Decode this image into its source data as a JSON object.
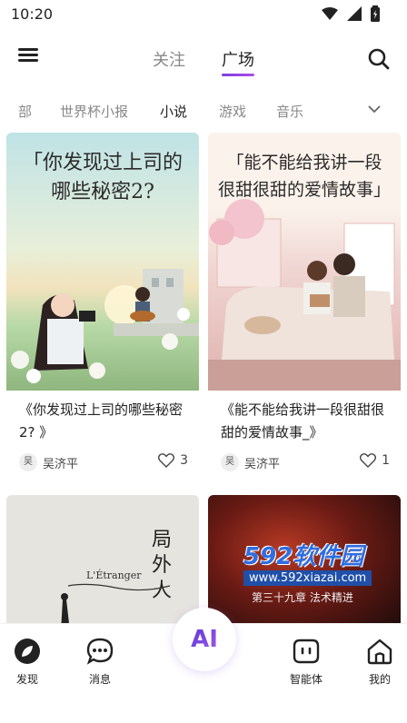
{
  "statusbar": {
    "time": "10:20"
  },
  "topnav": {
    "tabs": [
      {
        "label": "关注",
        "active": false
      },
      {
        "label": "广场",
        "active": true
      }
    ]
  },
  "categories": {
    "items": [
      "部",
      "世界杯小报",
      "小说",
      "游戏",
      "音乐"
    ],
    "active": "小说"
  },
  "cards": [
    {
      "cover_title": "「你发现过上司的哪些秘密2?",
      "cover_title_line1": "「你发现过上司的",
      "cover_title_line2": "哪些秘密2?",
      "title": "《你发现过上司的哪些秘密2? 》",
      "author": "吴济平",
      "avatar_text": "吴",
      "likes": "3"
    },
    {
      "cover_title_line1": "「能不能给我讲一段",
      "cover_title_line2": "很甜很甜的爱情故事」",
      "title": "《能不能给我讲一段很甜很甜的爱情故事_》",
      "author": "吴济平",
      "avatar_text": "吴",
      "likes": "1"
    },
    {
      "cover_text_vertical": "局外人",
      "cover_text_script": "L'Étranger"
    },
    {
      "cover_text_chapter": "第三十九章 法术精进"
    }
  ],
  "bottomnav": {
    "items": [
      {
        "label": "发现",
        "icon": "compass-icon"
      },
      {
        "label": "消息",
        "icon": "chat-icon"
      },
      {
        "label": "智能体",
        "icon": "robot-icon"
      },
      {
        "label": "我的",
        "icon": "home-icon"
      }
    ],
    "ai_label": "AI"
  },
  "watermark": {
    "top": "592软件园",
    "bottom": "www.592xiazai.com"
  },
  "colors": {
    "accent": "#8a45e4",
    "text": "#222222",
    "muted": "#888888"
  }
}
